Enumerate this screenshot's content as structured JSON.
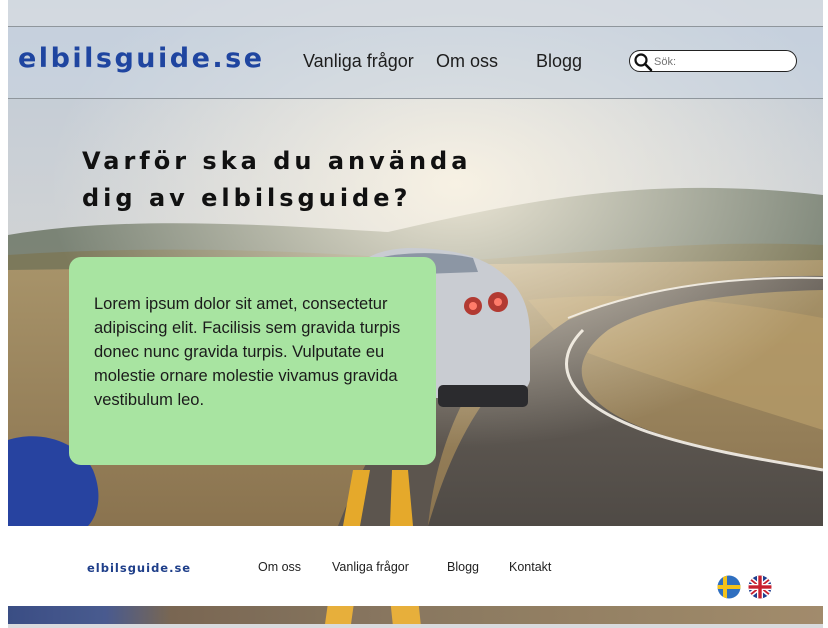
{
  "header": {
    "logo": "elbilsguide.se",
    "nav": [
      {
        "label": "Vanliga frågor"
      },
      {
        "label": "Om oss"
      },
      {
        "label": "Blogg"
      }
    ],
    "search": {
      "placeholder": "Sök:"
    }
  },
  "hero": {
    "headline_line1": "Varför ska du använda",
    "headline_line2": "dig av elbilsguide?",
    "card_text": "Lorem ipsum dolor sit amet, consectetur adipiscing elit. Facilisis sem gravida turpis donec nunc gravida turpis. Vulputate eu molestie ornare molestie vivamus gravida vestibulum leo."
  },
  "footer": {
    "logo": "elbilsguide.se",
    "links": [
      {
        "label": "Om oss"
      },
      {
        "label": "Vanliga frågor"
      },
      {
        "label": "Blogg"
      },
      {
        "label": "Kontakt"
      }
    ],
    "languages": [
      "swedish-flag-icon",
      "uk-flag-icon"
    ]
  },
  "colors": {
    "brand": "#1f45a0",
    "card": "#a8e4a1",
    "road_line": "#e5a92b"
  }
}
